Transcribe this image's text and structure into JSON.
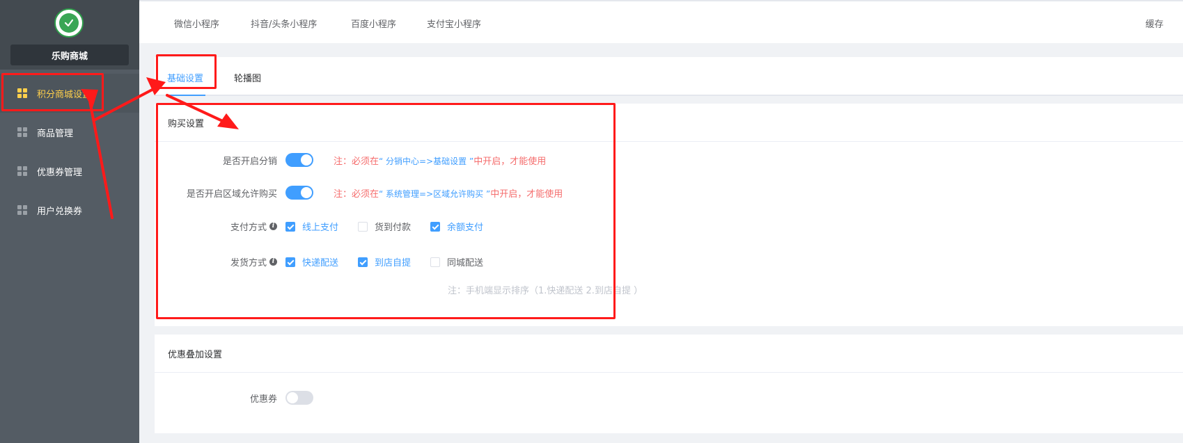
{
  "sidebar": {
    "store_name": "乐购商城",
    "items": [
      {
        "label": "积分商城设置",
        "active": true
      },
      {
        "label": "商品管理",
        "active": false
      },
      {
        "label": "优惠券管理",
        "active": false
      },
      {
        "label": "用户兑换券",
        "active": false
      }
    ]
  },
  "topbar": {
    "tabs": [
      "微信小程序",
      "抖音/头条小程序",
      "百度小程序",
      "支付宝小程序"
    ],
    "cache_label": "缓存"
  },
  "tabs": {
    "items": [
      {
        "label": "基础设置",
        "active": true
      },
      {
        "label": "轮播图",
        "active": false
      }
    ]
  },
  "purchase": {
    "title": "购买设置",
    "distribution": {
      "label": "是否开启分销",
      "enabled": true,
      "note_prefix": "注：必须在",
      "note_link": "“ 分销中心=>基础设置 ”",
      "note_suffix": "中开启，才能使用"
    },
    "region": {
      "label": "是否开启区域允许购买",
      "enabled": true,
      "note_prefix": "注：必须在",
      "note_link": "“ 系统管理=>区域允许购买 ”",
      "note_suffix": "中开启，才能使用"
    },
    "payment": {
      "label": "支付方式",
      "options": [
        {
          "label": "线上支付",
          "checked": true
        },
        {
          "label": "货到付款",
          "checked": false
        },
        {
          "label": "余额支付",
          "checked": true
        }
      ]
    },
    "delivery": {
      "label": "发货方式",
      "options": [
        {
          "label": "快递配送",
          "checked": true
        },
        {
          "label": "到店自提",
          "checked": true
        },
        {
          "label": "同城配送",
          "checked": false
        }
      ],
      "hint": "注：手机端显示排序（1.快递配送 2.到店自提 ）"
    }
  },
  "discount": {
    "title": "优惠叠加设置",
    "coupon": {
      "label": "优惠券",
      "enabled": false
    }
  },
  "colors": {
    "accent": "#409eff",
    "sidebar_bg": "#545c64",
    "active_menu": "#ffd04b",
    "warning_text": "#f56c6c",
    "annotation": "#ff1a1a"
  }
}
